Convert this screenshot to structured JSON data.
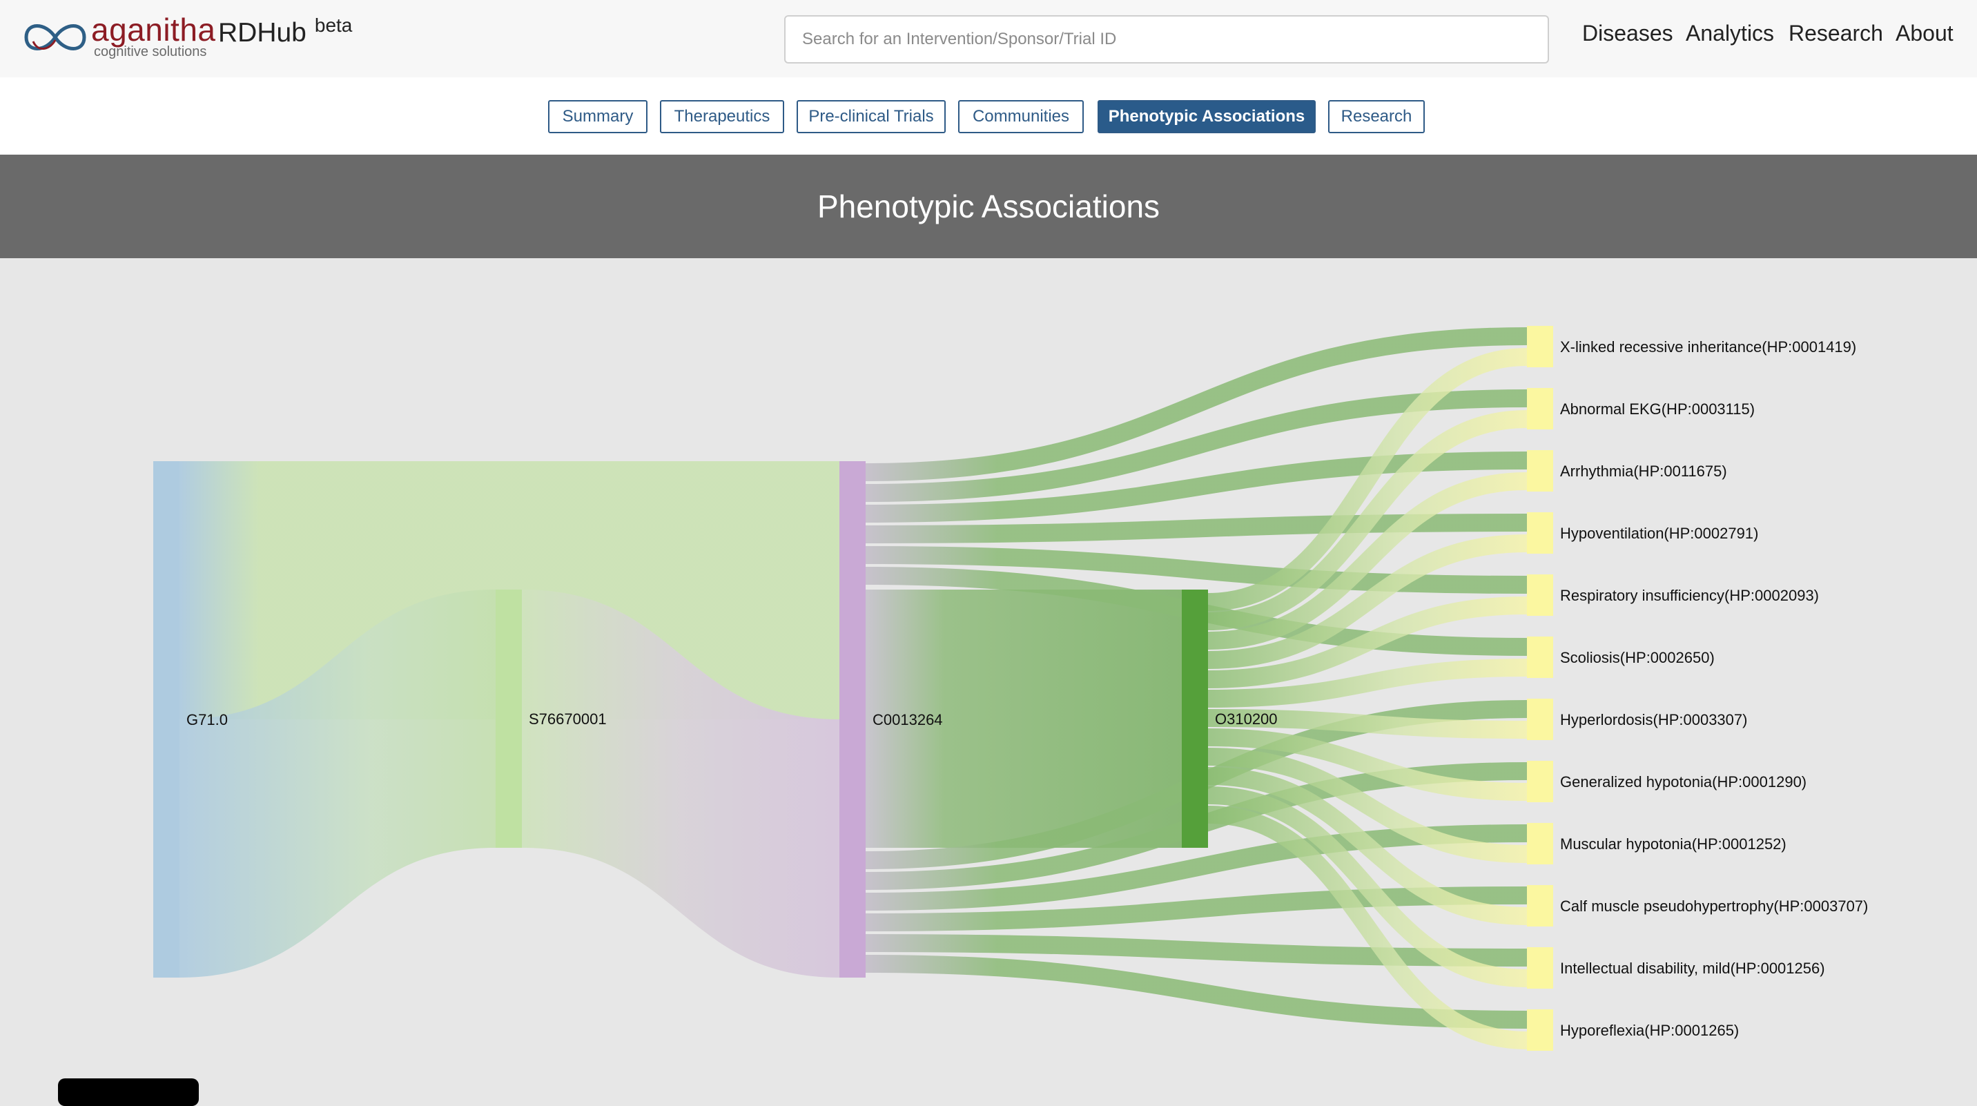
{
  "header": {
    "logo_name": "aganitha",
    "logo_tagline": "cognitive solutions",
    "app_name": "RDHub",
    "app_badge": "beta",
    "search_placeholder": "Search for an Intervention/Sponsor/Trial ID",
    "nav": [
      "Diseases",
      "Analytics",
      "Research",
      "About"
    ]
  },
  "tabs": [
    {
      "label": "Summary",
      "active": false
    },
    {
      "label": "Therapeutics",
      "active": false
    },
    {
      "label": "Pre-clinical Trials",
      "active": false
    },
    {
      "label": "Communities",
      "active": false
    },
    {
      "label": "Phenotypic Associations",
      "active": true
    },
    {
      "label": "Research",
      "active": false
    }
  ],
  "section_title": "Phenotypic Associations",
  "colors": {
    "brand": "#8c1c24",
    "tab_accent": "#2a5b8a",
    "banner": "#6a6a6a",
    "node_disease": "#aecbe0",
    "node_study": "#bfe1a2",
    "node_concept": "#c9a9d5",
    "node_ontology": "#55a03a",
    "node_phenotype": "#fbf7a0"
  },
  "chart_data": {
    "type": "sankey",
    "nodes": [
      {
        "id": "G71.0",
        "column": 0
      },
      {
        "id": "S76670001",
        "column": 1
      },
      {
        "id": "C0013264",
        "column": 2
      },
      {
        "id": "O310200",
        "column": 3
      },
      {
        "id": "X-linked recessive inheritance(HP:0001419)",
        "column": 4
      },
      {
        "id": "Abnormal EKG(HP:0003115)",
        "column": 4
      },
      {
        "id": "Arrhythmia(HP:0011675)",
        "column": 4
      },
      {
        "id": "Hypoventilation(HP:0002791)",
        "column": 4
      },
      {
        "id": "Respiratory insufficiency(HP:0002093)",
        "column": 4
      },
      {
        "id": "Scoliosis(HP:0002650)",
        "column": 4
      },
      {
        "id": "Hyperlordosis(HP:0003307)",
        "column": 4
      },
      {
        "id": "Generalized hypotonia(HP:0001290)",
        "column": 4
      },
      {
        "id": "Muscular hypotonia(HP:0001252)",
        "column": 4
      },
      {
        "id": "Calf muscle pseudohypertrophy(HP:0003707)",
        "column": 4
      },
      {
        "id": "Intellectual disability, mild(HP:0001256)",
        "column": 4
      },
      {
        "id": "Hyporeflexia(HP:0001265)",
        "column": 4
      }
    ],
    "links": [
      {
        "source": "G71.0",
        "target": "C0013264",
        "value": 1
      },
      {
        "source": "G71.0",
        "target": "S76670001",
        "value": 1
      },
      {
        "source": "S76670001",
        "target": "C0013264",
        "value": 1
      },
      {
        "source": "C0013264",
        "target": "O310200",
        "value": 1
      },
      {
        "source": "C0013264",
        "target": "X-linked recessive inheritance(HP:0001419)",
        "value": 1
      },
      {
        "source": "C0013264",
        "target": "Abnormal EKG(HP:0003115)",
        "value": 1
      },
      {
        "source": "C0013264",
        "target": "Arrhythmia(HP:0011675)",
        "value": 1
      },
      {
        "source": "C0013264",
        "target": "Hypoventilation(HP:0002791)",
        "value": 1
      },
      {
        "source": "C0013264",
        "target": "Respiratory insufficiency(HP:0002093)",
        "value": 1
      },
      {
        "source": "C0013264",
        "target": "Scoliosis(HP:0002650)",
        "value": 1
      },
      {
        "source": "C0013264",
        "target": "Hyperlordosis(HP:0003307)",
        "value": 1
      },
      {
        "source": "C0013264",
        "target": "Generalized hypotonia(HP:0001290)",
        "value": 1
      },
      {
        "source": "C0013264",
        "target": "Muscular hypotonia(HP:0001252)",
        "value": 1
      },
      {
        "source": "C0013264",
        "target": "Calf muscle pseudohypertrophy(HP:0003707)",
        "value": 1
      },
      {
        "source": "C0013264",
        "target": "Intellectual disability, mild(HP:0001256)",
        "value": 1
      },
      {
        "source": "C0013264",
        "target": "Hyporeflexia(HP:0001265)",
        "value": 1
      },
      {
        "source": "O310200",
        "target": "X-linked recessive inheritance(HP:0001419)",
        "value": 1
      },
      {
        "source": "O310200",
        "target": "Abnormal EKG(HP:0003115)",
        "value": 1
      },
      {
        "source": "O310200",
        "target": "Arrhythmia(HP:0011675)",
        "value": 1
      },
      {
        "source": "O310200",
        "target": "Hypoventilation(HP:0002791)",
        "value": 1
      },
      {
        "source": "O310200",
        "target": "Respiratory insufficiency(HP:0002093)",
        "value": 1
      },
      {
        "source": "O310200",
        "target": "Scoliosis(HP:0002650)",
        "value": 1
      },
      {
        "source": "O310200",
        "target": "Hyperlordosis(HP:0003307)",
        "value": 1
      },
      {
        "source": "O310200",
        "target": "Generalized hypotonia(HP:0001290)",
        "value": 1
      },
      {
        "source": "O310200",
        "target": "Muscular hypotonia(HP:0001252)",
        "value": 1
      },
      {
        "source": "O310200",
        "target": "Calf muscle pseudohypertrophy(HP:0003707)",
        "value": 1
      },
      {
        "source": "O310200",
        "target": "Intellectual disability, mild(HP:0001256)",
        "value": 1
      },
      {
        "source": "O310200",
        "target": "Hyporeflexia(HP:0001265)",
        "value": 1
      }
    ]
  }
}
